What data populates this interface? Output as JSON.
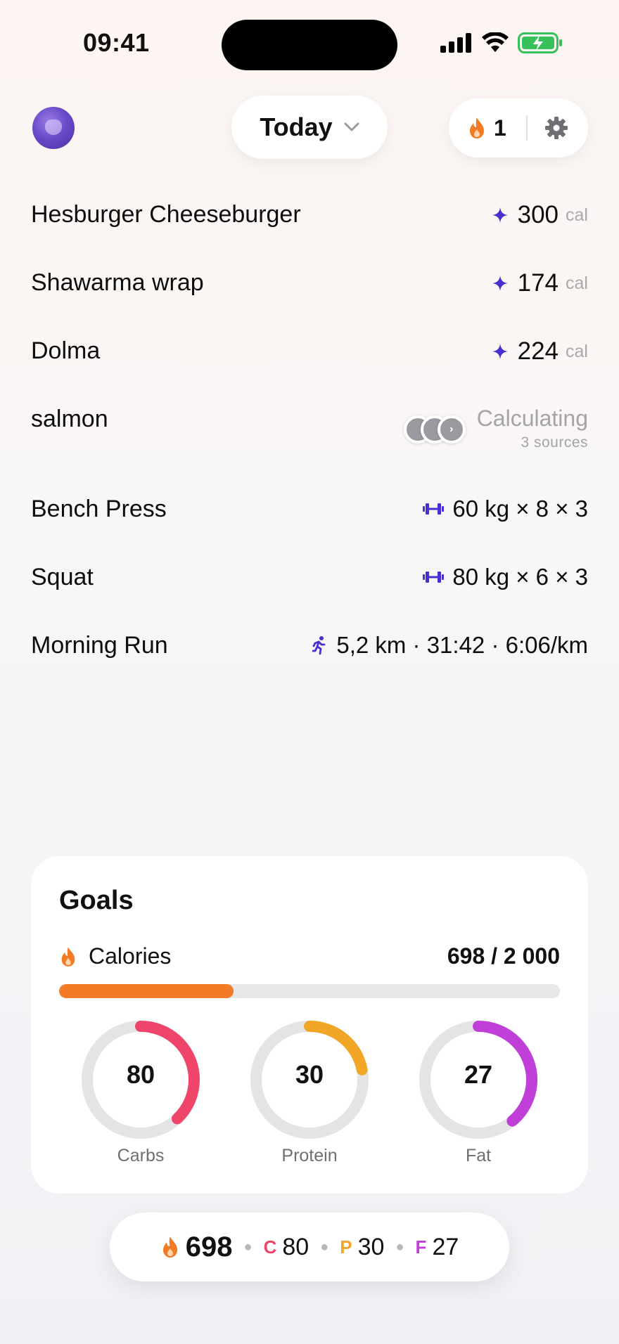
{
  "status_bar": {
    "time": "09:41"
  },
  "header": {
    "date_selector": "Today",
    "streak_count": "1"
  },
  "entries": [
    {
      "name": "Hesburger Cheeseburger",
      "value": "300",
      "unit": "cal"
    },
    {
      "name": "Shawarma wrap",
      "value": "174",
      "unit": "cal"
    },
    {
      "name": "Dolma",
      "value": "224",
      "unit": "cal"
    }
  ],
  "pending": {
    "name": "salmon",
    "status": "Calculating",
    "sources": "3 sources"
  },
  "exercises": [
    {
      "name": "Bench Press",
      "detail": "60 kg × 8 × 3",
      "icon": "dumbbell-icon"
    },
    {
      "name": "Squat",
      "detail": "80 kg × 6 × 3",
      "icon": "dumbbell-icon"
    },
    {
      "name": "Morning Run",
      "detail": "5,2 km · 31:42 · 6:06/km",
      "icon": "running-icon"
    }
  ],
  "goals": {
    "title": "Goals",
    "calories_label": "Calories",
    "calories_value": "698 / 2 000",
    "calories_progress": 0.349,
    "rings": [
      {
        "label": "Carbs",
        "value": "80",
        "progress": 0.38,
        "color": "#f0456a"
      },
      {
        "label": "Protein",
        "value": "30",
        "progress": 0.22,
        "color": "#f2a626"
      },
      {
        "label": "Fat",
        "value": "27",
        "progress": 0.39,
        "color": "#c03fd9"
      }
    ]
  },
  "summary": {
    "calories": "698",
    "carbs_letter": "C",
    "carbs": "80",
    "protein_letter": "P",
    "protein": "30",
    "fat_letter": "F",
    "fat": "27"
  },
  "colors": {
    "accent": "#4a2fd0",
    "flame": "#f47b25",
    "carbs": "#f0456a",
    "protein": "#f2a626",
    "fat": "#c03fd9"
  }
}
